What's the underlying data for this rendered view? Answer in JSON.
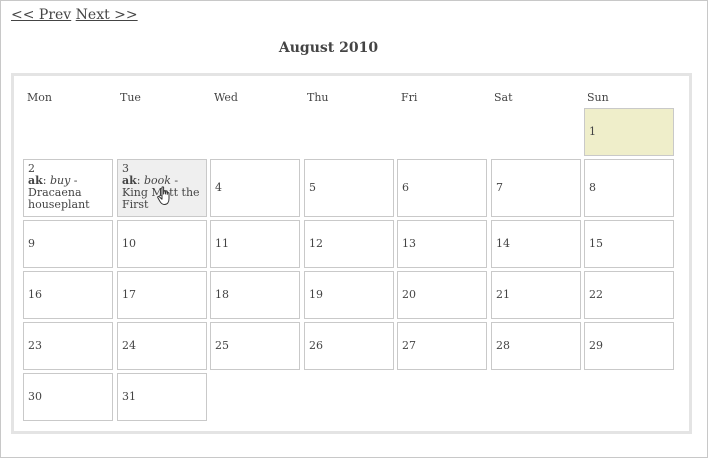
{
  "nav": {
    "prev_label": "<< Prev",
    "next_label": "Next >>"
  },
  "calendar": {
    "title": "August 2010",
    "weekdays": [
      "Mon",
      "Tue",
      "Wed",
      "Thu",
      "Fri",
      "Sat",
      "Sun"
    ],
    "highlighted_day": "1",
    "hovered_day": "3",
    "events": {
      "day2": {
        "day": "2",
        "user": "ak",
        "action": "buy",
        "sep": " - ",
        "title": "Dracaena houseplant"
      },
      "day3": {
        "day": "3",
        "user": "ak",
        "action": "book",
        "sep": " - ",
        "title": "King Matt the First"
      }
    },
    "days": [
      "1",
      "4",
      "5",
      "6",
      "7",
      "8",
      "9",
      "10",
      "11",
      "12",
      "13",
      "14",
      "15",
      "16",
      "17",
      "18",
      "19",
      "20",
      "21",
      "22",
      "23",
      "24",
      "25",
      "26",
      "27",
      "28",
      "29",
      "30",
      "31"
    ]
  },
  "icons": {
    "cursor": "hand-pointer-icon"
  }
}
